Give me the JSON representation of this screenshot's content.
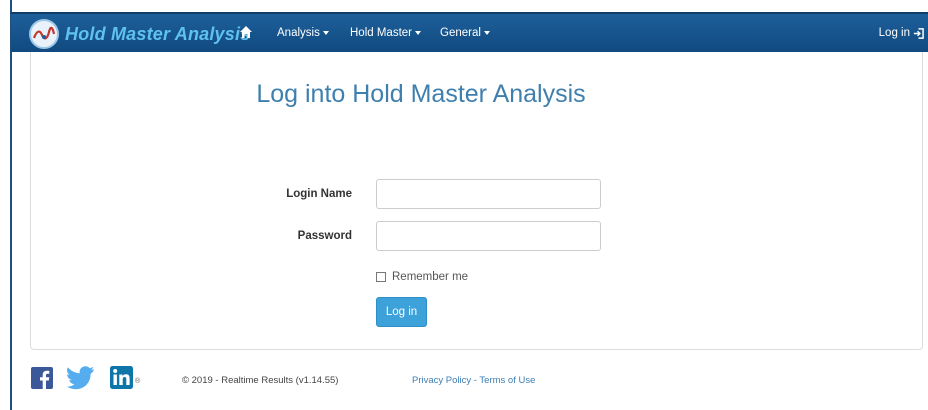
{
  "navbar": {
    "brand": "Hold Master Analysis",
    "menu": [
      {
        "label": "Analysis"
      },
      {
        "label": "Hold Master"
      },
      {
        "label": "General"
      }
    ],
    "login_label": "Log in"
  },
  "page": {
    "title": "Log into Hold Master Analysis"
  },
  "form": {
    "login_name_label": "Login Name",
    "login_name_value": "",
    "password_label": "Password",
    "password_value": "",
    "remember_label": "Remember me",
    "remember_checked": false,
    "submit_label": "Log in"
  },
  "footer": {
    "social": [
      "facebook-icon",
      "twitter-icon",
      "linkedin-icon"
    ],
    "registered_mark": "®",
    "copyright": "© 2019 - Realtime Results (v1.14.55)",
    "privacy": "Privacy Policy",
    "separator": " - ",
    "terms": "Terms of Use"
  },
  "colors": {
    "navbar": "#1d5f9a",
    "brand_text": "#5fc2ee",
    "title": "#3f7fae",
    "button": "#3ea2da",
    "link": "#3c7fb5"
  }
}
